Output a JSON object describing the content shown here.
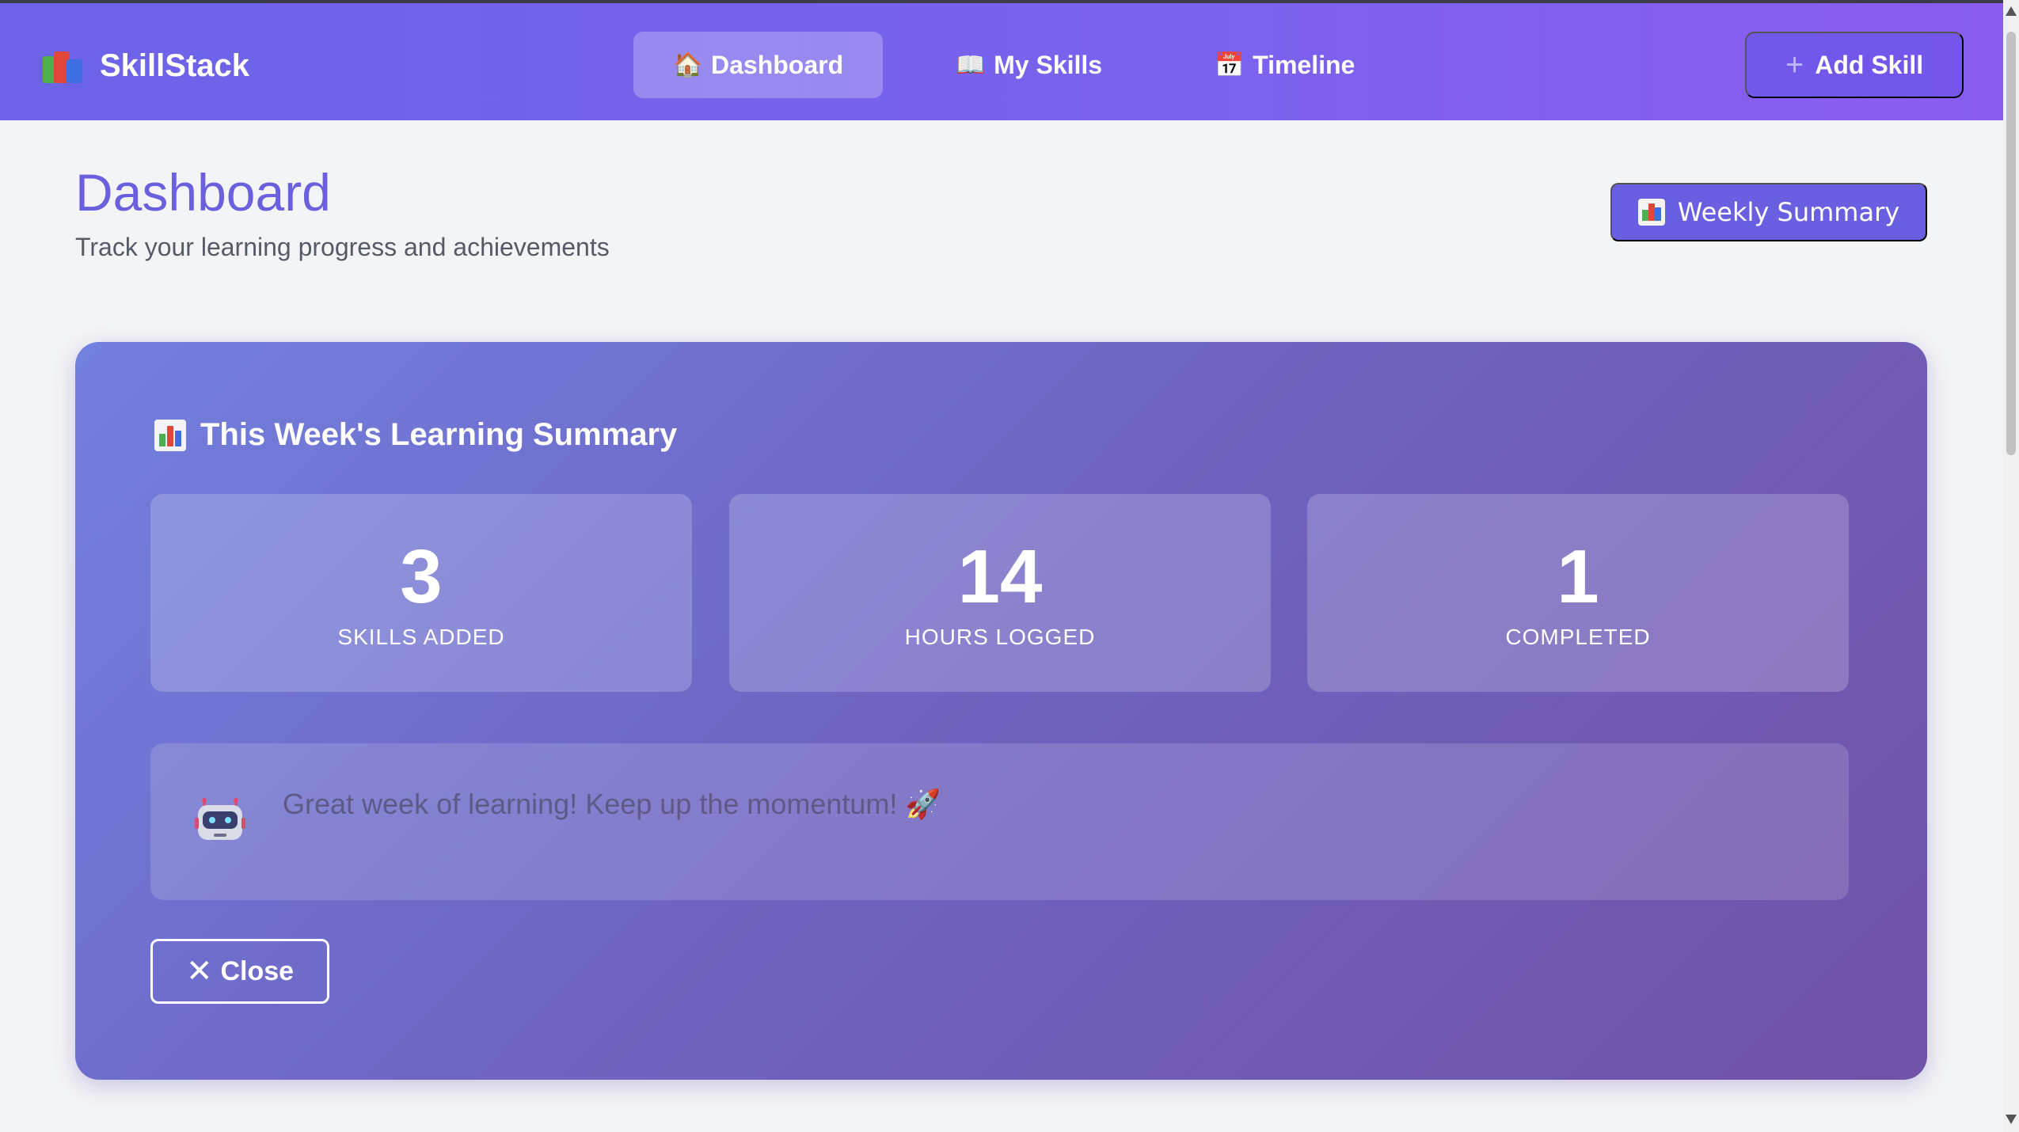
{
  "app": {
    "name": "SkillStack"
  },
  "nav": {
    "items": [
      {
        "label": "Dashboard",
        "icon": "🏠",
        "active": true
      },
      {
        "label": "My Skills",
        "icon": "📖",
        "active": false
      },
      {
        "label": "Timeline",
        "icon": "📅",
        "active": false
      }
    ],
    "add_skill_label": "Add Skill",
    "add_skill_icon": "+"
  },
  "page": {
    "title": "Dashboard",
    "subtitle": "Track your learning progress and achievements",
    "weekly_summary_label": "Weekly Summary"
  },
  "summary": {
    "heading": "This Week's Learning Summary",
    "stats": [
      {
        "value": "3",
        "label": "SKILLS ADDED"
      },
      {
        "value": "14",
        "label": "HOURS LOGGED"
      },
      {
        "value": "1",
        "label": "COMPLETED"
      }
    ],
    "ai_message": "Great week of learning! Keep up the momentum! 🚀",
    "close_label": "Close",
    "close_icon": "✕"
  },
  "colors": {
    "accent": "#6a5fdc",
    "topbar_start": "#6c63e8",
    "topbar_end": "#8a5cf0",
    "card_start": "#7280de",
    "card_end": "#7052a8",
    "background": "#f3f4f6"
  }
}
